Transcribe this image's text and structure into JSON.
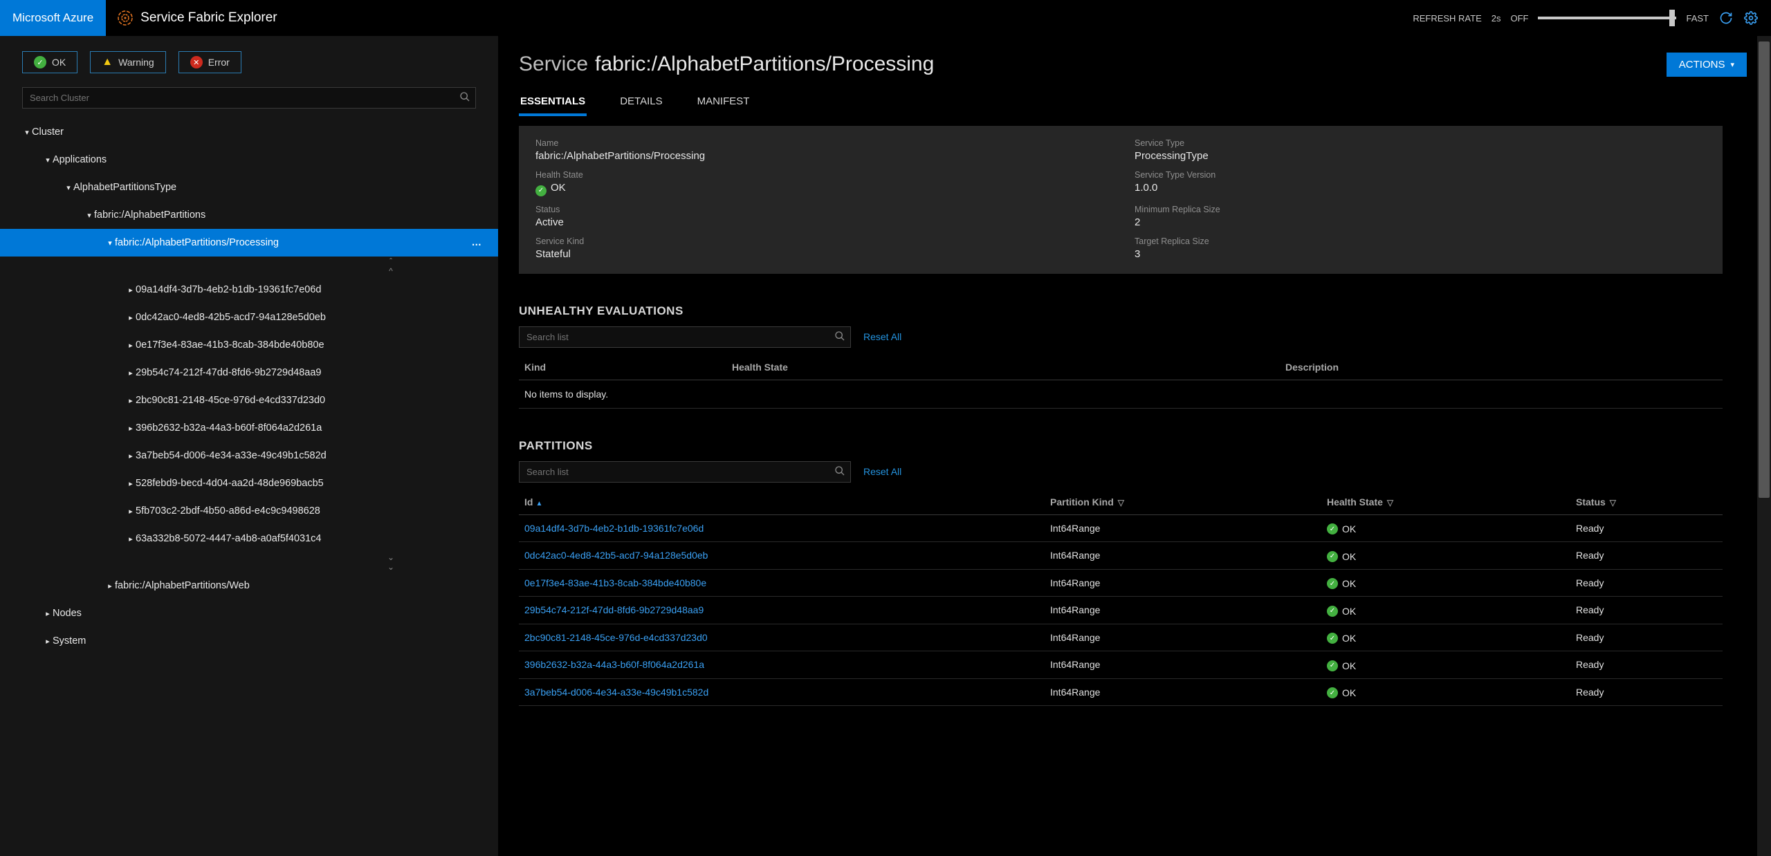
{
  "brand": {
    "azure": "Microsoft Azure",
    "sfx": "Service Fabric Explorer"
  },
  "topbar": {
    "refresh_rate_label": "REFRESH RATE",
    "refresh_rate_value": "2s",
    "slow": "OFF",
    "fast": "FAST"
  },
  "filters": {
    "ok": "OK",
    "warning": "Warning",
    "error": "Error"
  },
  "search": {
    "cluster_placeholder": "Search Cluster",
    "list_placeholder": "Search list",
    "reset_all": "Reset All"
  },
  "tree": {
    "cluster": "Cluster",
    "applications": "Applications",
    "app_type": "AlphabetPartitionsType",
    "app": "fabric:/AlphabetPartitions",
    "service_processing": "fabric:/AlphabetPartitions/Processing",
    "partitions": [
      "09a14df4-3d7b-4eb2-b1db-19361fc7e06d",
      "0dc42ac0-4ed8-42b5-acd7-94a128e5d0eb",
      "0e17f3e4-83ae-41b3-8cab-384bde40b80e",
      "29b54c74-212f-47dd-8fd6-9b2729d48aa9",
      "2bc90c81-2148-45ce-976d-e4cd337d23d0",
      "396b2632-b32a-44a3-b60f-8f064a2d261a",
      "3a7beb54-d006-4e34-a33e-49c49b1c582d",
      "528febd9-becd-4d04-aa2d-48de969bacb5",
      "5fb703c2-2bdf-4b50-a86d-e4c9c9498628",
      "63a332b8-5072-4447-a4b8-a0af5f4031c4"
    ],
    "service_web": "fabric:/AlphabetPartitions/Web",
    "nodes": "Nodes",
    "system": "System"
  },
  "page": {
    "title_prefix": "Service",
    "title_path": "fabric:/AlphabetPartitions/Processing",
    "actions": "ACTIONS"
  },
  "tabs": {
    "essentials": "ESSENTIALS",
    "details": "DETAILS",
    "manifest": "MANIFEST"
  },
  "essentials": {
    "name_label": "Name",
    "name_value": "fabric:/AlphabetPartitions/Processing",
    "service_type_label": "Service Type",
    "service_type_value": "ProcessingType",
    "health_state_label": "Health State",
    "health_state_value": "OK",
    "service_type_version_label": "Service Type Version",
    "service_type_version_value": "1.0.0",
    "status_label": "Status",
    "status_value": "Active",
    "min_replica_label": "Minimum Replica Size",
    "min_replica_value": "2",
    "service_kind_label": "Service Kind",
    "service_kind_value": "Stateful",
    "target_replica_label": "Target Replica Size",
    "target_replica_value": "3"
  },
  "sections": {
    "unhealthy": "UNHEALTHY EVALUATIONS",
    "partitions": "PARTITIONS",
    "no_items": "No items to display."
  },
  "eval_headers": {
    "kind": "Kind",
    "health_state": "Health State",
    "description": "Description"
  },
  "part_headers": {
    "id": "Id",
    "partition_kind": "Partition Kind",
    "health_state": "Health State",
    "status": "Status"
  },
  "partitions_table": [
    {
      "id": "09a14df4-3d7b-4eb2-b1db-19361fc7e06d",
      "kind": "Int64Range",
      "health": "OK",
      "status": "Ready"
    },
    {
      "id": "0dc42ac0-4ed8-42b5-acd7-94a128e5d0eb",
      "kind": "Int64Range",
      "health": "OK",
      "status": "Ready"
    },
    {
      "id": "0e17f3e4-83ae-41b3-8cab-384bde40b80e",
      "kind": "Int64Range",
      "health": "OK",
      "status": "Ready"
    },
    {
      "id": "29b54c74-212f-47dd-8fd6-9b2729d48aa9",
      "kind": "Int64Range",
      "health": "OK",
      "status": "Ready"
    },
    {
      "id": "2bc90c81-2148-45ce-976d-e4cd337d23d0",
      "kind": "Int64Range",
      "health": "OK",
      "status": "Ready"
    },
    {
      "id": "396b2632-b32a-44a3-b60f-8f064a2d261a",
      "kind": "Int64Range",
      "health": "OK",
      "status": "Ready"
    },
    {
      "id": "3a7beb54-d006-4e34-a33e-49c49b1c582d",
      "kind": "Int64Range",
      "health": "OK",
      "status": "Ready"
    }
  ]
}
